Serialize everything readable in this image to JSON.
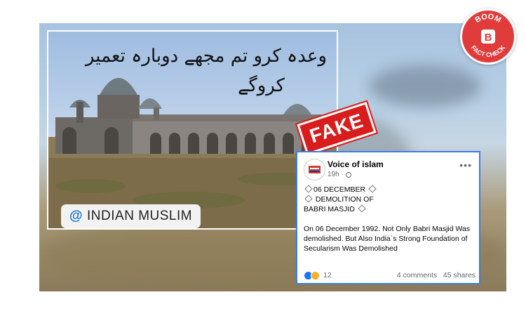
{
  "photo": {
    "urdu_line1": "وعدہ کرو تم مجھے دوبارہ تعمیر",
    "urdu_line2": "کروگے",
    "handle_at": "@",
    "handle_name": "INDIAN MUSLIM"
  },
  "stamp": {
    "label": "FAKE",
    "color": "#d91c1c"
  },
  "logo": {
    "top": "BOOM",
    "bottom": "FACT CHECK",
    "letter": "B",
    "color": "#e23b3b"
  },
  "post": {
    "page_name": "Voice of islam",
    "time": "19h",
    "line1": "06 DECEMBER",
    "line2": "DEMOLITION OF",
    "line3": "BABRI MASJID",
    "paragraph": "On 06 December 1992. Not Only Babri Masjid Was demolished. But Also India`s Strong Foundation of Secularism Was Demolished",
    "reaction_count": "12",
    "comments": "4 comments",
    "shares": "45 shares",
    "more_icon": "•••"
  }
}
